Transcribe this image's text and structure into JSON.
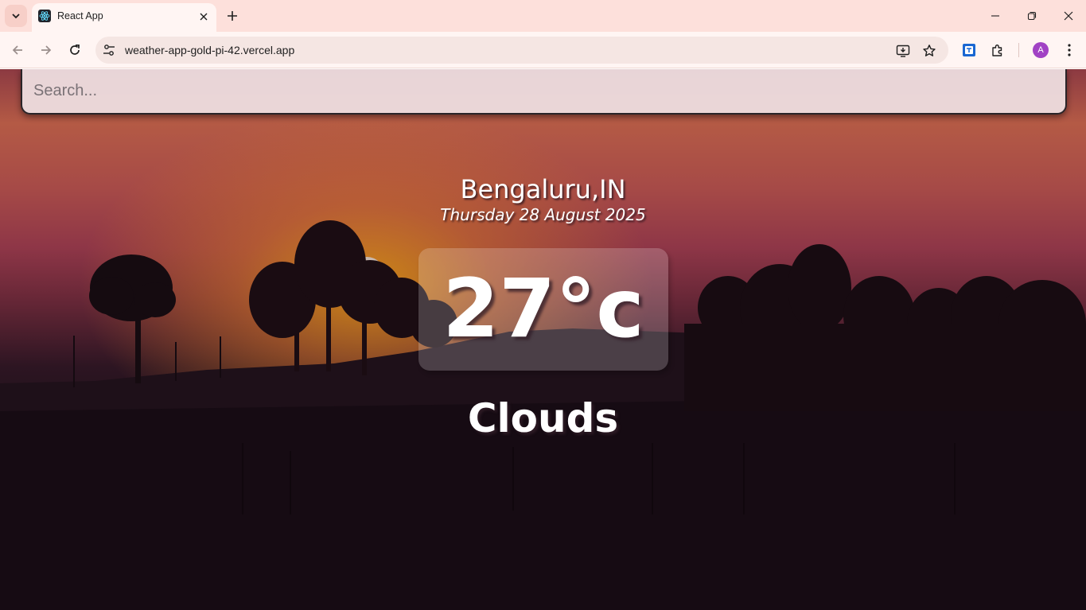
{
  "browser": {
    "tab_title": "React App",
    "url": "weather-app-gold-pi-42.vercel.app",
    "profile_initial": "A"
  },
  "app": {
    "search_placeholder": "Search...",
    "location": "Bengaluru,IN",
    "date": "Thursday 28 August 2025",
    "temperature": "27°c",
    "condition": "Clouds"
  },
  "colors": {
    "tabbar_bg": "#fde0db",
    "toolbar_bg": "#fff5f3",
    "avatar": "#a142c4"
  },
  "icons": {
    "tab_list": "chevron-down-icon",
    "favicon": "react-icon",
    "tab_close": "close-icon",
    "new_tab": "plus-icon",
    "back": "arrow-left-icon",
    "forward": "arrow-right-icon",
    "reload": "reload-icon",
    "site_info": "tune-icon",
    "install": "install-app-icon",
    "bookmark": "star-icon",
    "extension_1": "translate-icon",
    "extensions": "puzzle-icon",
    "menu": "kebab-menu-icon"
  }
}
